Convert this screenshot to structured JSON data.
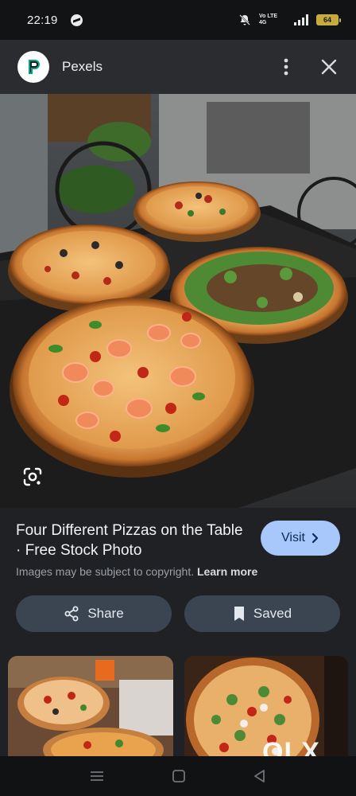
{
  "status_bar": {
    "time": "22:19",
    "network": "Vo LTE 4G",
    "battery": "64"
  },
  "header": {
    "site_name": "Pexels",
    "logo_icon": "pexels-logo-icon",
    "more_icon": "more-vert-icon",
    "close_icon": "close-icon"
  },
  "image": {
    "lens_icon": "google-lens-icon"
  },
  "result": {
    "title": "Four Different Pizzas on the Table · Free Stock Photo",
    "visit_label": "Visit",
    "copyright_text": "Images may be subject to copyright.",
    "learn_more_label": "Learn more",
    "share_label": "Share",
    "saved_label": "Saved"
  },
  "watermark": {
    "text": "OLX"
  },
  "colors": {
    "accent": "#a8c7fa",
    "button_bg": "#3b4551",
    "background": "#1f2124"
  }
}
